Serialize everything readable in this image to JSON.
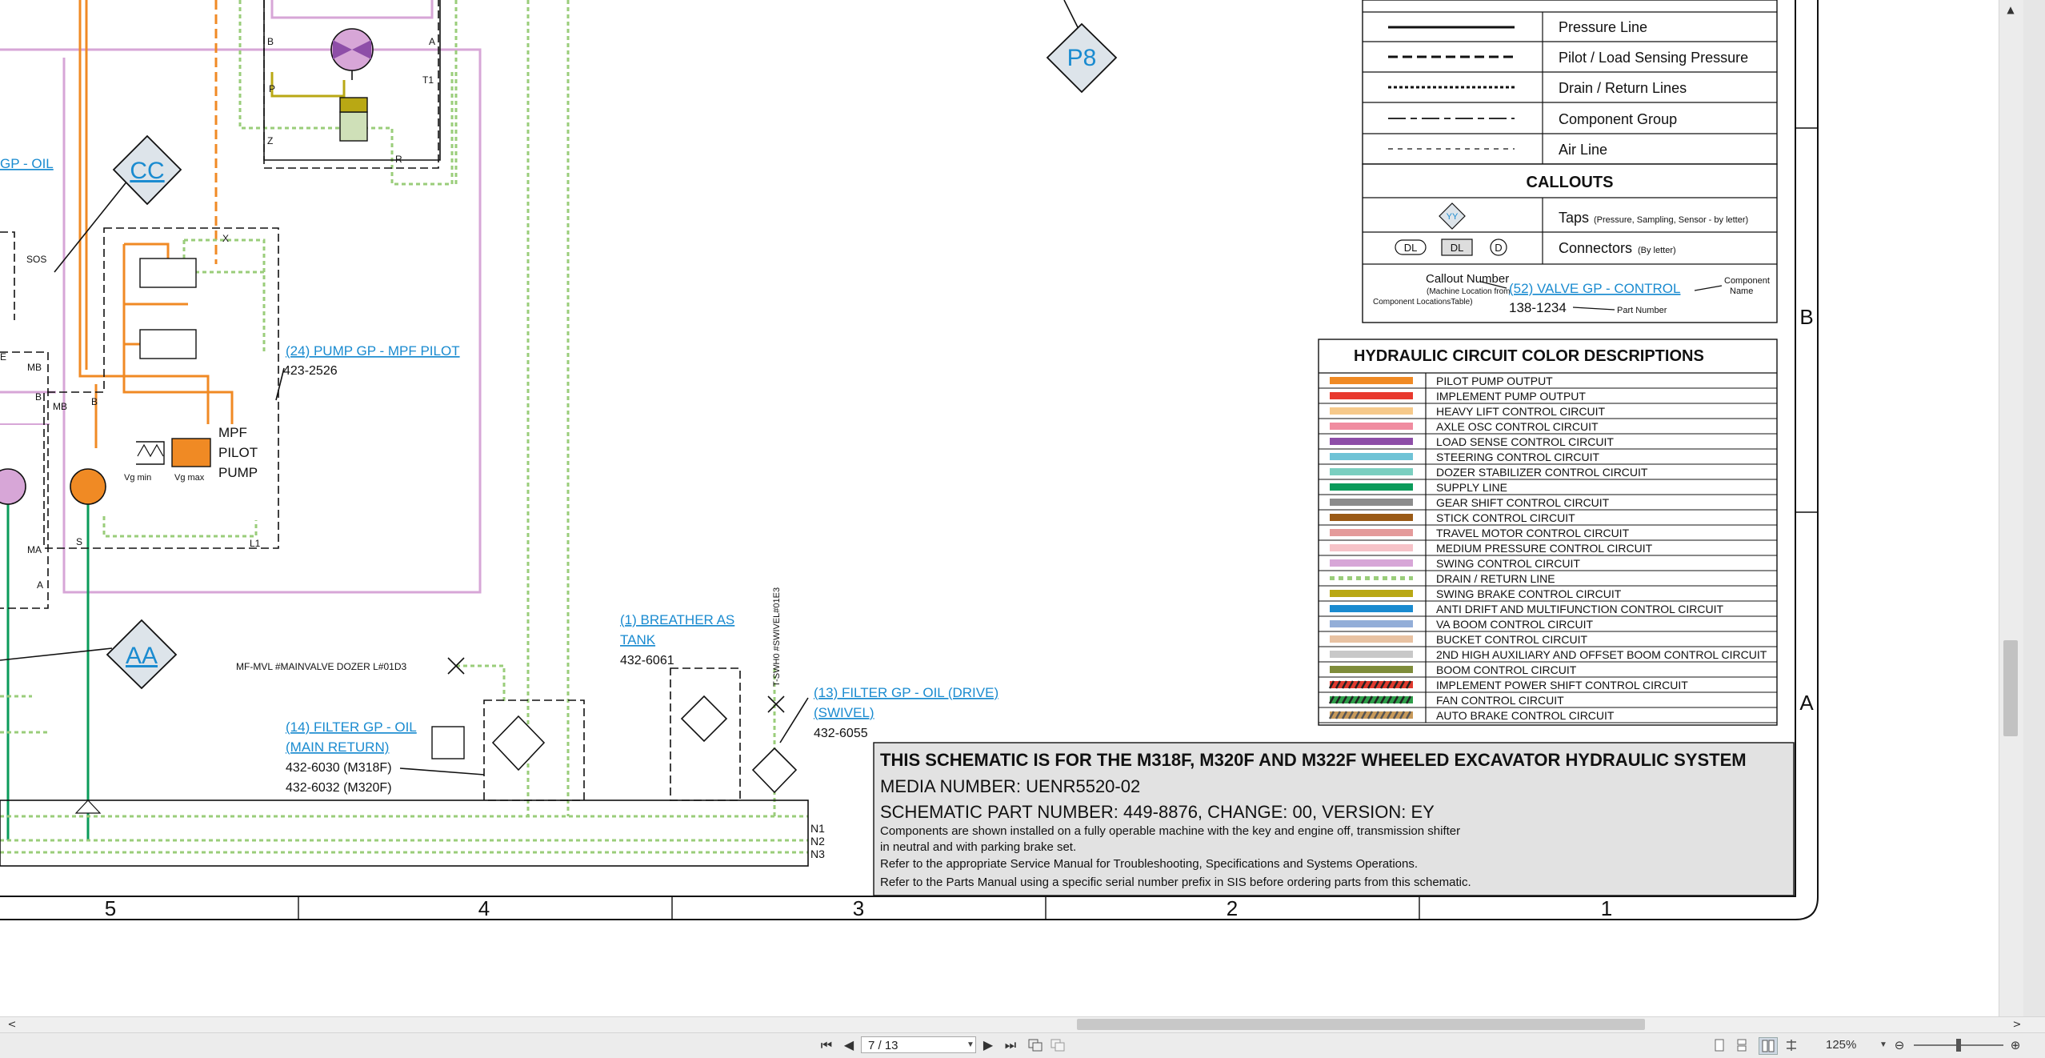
{
  "legend": {
    "line_patterns": [
      "Pressure Line",
      "Pilot / Load Sensing Pressure",
      "Drain / Return Lines",
      "Component Group",
      "Air Line"
    ],
    "callouts_title": "CALLOUTS",
    "tap_symbol": "YY",
    "taps_label": "Taps",
    "taps_note": "(Pressure, Sampling, Sensor - by letter)",
    "connector_dl1": "DL",
    "connector_dl2": "DL",
    "connector_d": "D",
    "connectors_label": "Connectors",
    "connectors_note": "(By letter)",
    "callout_number": "Callout Number",
    "callout_machine_1": "(Machine Location from",
    "callout_machine_2": "Component LocationsTable)",
    "callout_example": "(52) VALVE GP - CONTROL",
    "component_label_1": "Component",
    "component_label_2": "Name",
    "part_example": "138-1234",
    "part_label": "Part Number"
  },
  "colors": {
    "title": "HYDRAULIC CIRCUIT COLOR DESCRIPTIONS",
    "items": [
      {
        "label": "PILOT PUMP OUTPUT",
        "color": "#F08A24"
      },
      {
        "label": "IMPLEMENT PUMP OUTPUT",
        "color": "#E8392E"
      },
      {
        "label": "HEAVY LIFT CONTROL CIRCUIT",
        "color": "#F6C98A"
      },
      {
        "label": "AXLE OSC CONTROL CIRCUIT",
        "color": "#F08CA0"
      },
      {
        "label": "LOAD SENSE CONTROL CIRCUIT",
        "color": "#8E4EA8"
      },
      {
        "label": "STEERING CONTROL CIRCUIT",
        "color": "#6FC3D6"
      },
      {
        "label": "DOZER STABILIZER CONTROL CIRCUIT",
        "color": "#7BCFC0"
      },
      {
        "label": "SUPPLY LINE",
        "color": "#0A9B5A"
      },
      {
        "label": "GEAR SHIFT CONTROL CIRCUIT",
        "color": "#8C8C8C"
      },
      {
        "label": "STICK CONTROL CIRCUIT",
        "color": "#9A5A16"
      },
      {
        "label": "TRAVEL MOTOR CONTROL CIRCUIT",
        "color": "#E49A9A"
      },
      {
        "label": "MEDIUM PRESSURE CONTROL CIRCUIT",
        "color": "#F6C3C8"
      },
      {
        "label": "SWING CONTROL CIRCUIT",
        "color": "#D7A6D7"
      },
      {
        "label": "DRAIN / RETURN LINE",
        "color": "#9ACD7A",
        "pattern": "dotted"
      },
      {
        "label": "SWING BRAKE CONTROL CIRCUIT",
        "color": "#B9A814"
      },
      {
        "label": "ANTI DRIFT AND MULTIFUNCTION CONTROL CIRCUIT",
        "color": "#1A8BD0"
      },
      {
        "label": "VA BOOM CONTROL CIRCUIT",
        "color": "#93AED8"
      },
      {
        "label": "BUCKET CONTROL CIRCUIT",
        "color": "#E8C2A2"
      },
      {
        "label": "2ND HIGH AUXILIARY AND OFFSET BOOM CONTROL CIRCUIT",
        "color": "#C8C8C8"
      },
      {
        "label": "BOOM CONTROL CIRCUIT",
        "color": "#7E8C3A"
      },
      {
        "label": "IMPLEMENT POWER SHIFT CONTROL CIRCUIT",
        "color": "#E03A2E",
        "pattern": "striped",
        "stripe": "#222222"
      },
      {
        "label": "FAN CONTROL CIRCUIT",
        "color": "#2E9E4A",
        "pattern": "striped",
        "stripe": "#222222"
      },
      {
        "label": "AUTO BRAKE CONTROL CIRCUIT",
        "color": "#C89A5A",
        "pattern": "striped",
        "stripe": "#555555"
      }
    ]
  },
  "title_block": {
    "heading": "THIS SCHEMATIC IS FOR THE M318F, M320F AND M322F WHEELED EXCAVATOR HYDRAULIC SYSTEM",
    "media": "MEDIA NUMBER: UENR5520-02",
    "part": "SCHEMATIC PART NUMBER: 449-8876, CHANGE: 00, VERSION: EY",
    "note1": "Components are shown installed on a fully operable machine with the key and engine off, transmission shifter",
    "note2": "in neutral and with parking brake set.",
    "note3": "Refer to the appropriate Service Manual for Troubleshooting, Specifications and Systems Operations.",
    "note4": "Refer to the Parts Manual using a specific serial number prefix in SIS before ordering parts from this schematic."
  },
  "zones": {
    "columns": [
      "5",
      "4",
      "3",
      "2",
      "1"
    ],
    "rows": [
      "B",
      "A"
    ]
  },
  "schematic": {
    "tap_p8": "P8",
    "tap_cc": "CC",
    "tap_aa": "AA",
    "gp_oil": "GP - OIL",
    "sos": "SOS",
    "pump_callout": "(24) PUMP GP - MPF PILOT",
    "pump_part": "423-2526",
    "pump_name_1": "MPF",
    "pump_name_2": "PILOT",
    "pump_name_3": "PUMP",
    "vg_min": "Vg min",
    "vg_max": "Vg max",
    "mainvalve": "MF-MVL #MAINVALVE DOZER L#01D3",
    "filter14_1": "(14) FILTER GP - OIL",
    "filter14_2": "(MAIN RETURN)",
    "filter14_p1": "432-6030  (M318F)",
    "filter14_p2": "432-6032  (M320F)",
    "breather_1": "(1) BREATHER AS",
    "breather_2": "TANK",
    "breather_part": "432-6061",
    "swivel_tag": "T-SWH0 #SWIVEL#01E3",
    "filter13_1": "(13) FILTER GP - OIL (DRIVE)",
    "filter13_2": "(SWIVEL)",
    "filter13_part": "432-6055",
    "n1": "N1",
    "n2": "N2",
    "n3": "N3",
    "port_labels": [
      "B",
      "A",
      "P",
      "T1",
      "Z",
      "R",
      "X",
      "MB",
      "MB",
      "B",
      "B",
      "MA",
      "A",
      "S",
      "L1",
      "E"
    ]
  },
  "toolbar": {
    "page": "7 / 13",
    "zoom": "125%"
  }
}
